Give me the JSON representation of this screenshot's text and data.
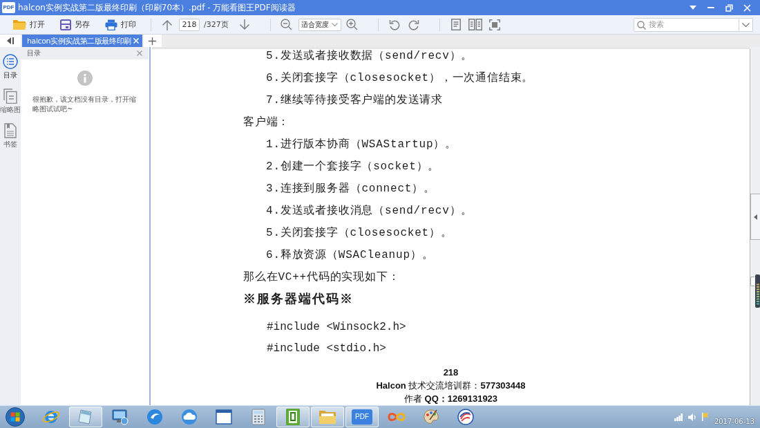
{
  "window": {
    "app_icon_label": "PDF",
    "title": "halcon实例实战第二版最终印刷（印刷70本）.pdf - 万能看图王PDF阅读器"
  },
  "toolbar": {
    "file_buttons": [
      {
        "kind": "open",
        "label": "打开"
      },
      {
        "kind": "save",
        "label": "另存"
      },
      {
        "kind": "print",
        "label": "打印"
      }
    ],
    "page": {
      "current": "218",
      "total": "/327页"
    },
    "zoom_mode": "适合宽度",
    "search": {
      "placeholder": "搜索"
    }
  },
  "tabs": [
    {
      "label": "halcon实例实战第二版最终印刷",
      "selected": true
    }
  ],
  "side_rail": [
    {
      "kind": "toc",
      "label": "目录",
      "selected": true
    },
    {
      "kind": "thumbnails",
      "label": "缩略图",
      "selected": false
    },
    {
      "kind": "bookmarks",
      "label": "书签",
      "selected": false
    }
  ],
  "panel": {
    "title": "目录",
    "message": "很抱歉，该文档没有目录，打开缩略图试试吧~"
  },
  "document": {
    "lines": [
      {
        "kind": "item",
        "text": "5.发送或者接收数据（send/recv）。"
      },
      {
        "kind": "item",
        "text": "6.关闭套接字（closesocket），一次通信结束。"
      },
      {
        "kind": "item",
        "text": "7.继续等待接受客户端的发送请求"
      },
      {
        "kind": "heading",
        "text": "客户端："
      },
      {
        "kind": "item",
        "text": "1.进行版本协商（WSAStartup）。"
      },
      {
        "kind": "item",
        "text": "2.创建一个套接字（socket）。"
      },
      {
        "kind": "item",
        "text": "3.连接到服务器（connect）。"
      },
      {
        "kind": "item",
        "text": "4.发送或者接收消息（send/recv）。"
      },
      {
        "kind": "item",
        "text": "5.关闭套接字（closesocket）。"
      },
      {
        "kind": "item",
        "text": "6.释放资源（WSACleanup）。"
      },
      {
        "kind": "heading",
        "text": "那么在VC++代码的实现如下："
      },
      {
        "kind": "section",
        "text": "※服务器端代码※"
      },
      {
        "kind": "code",
        "text": "#include <Winsock2.h>"
      },
      {
        "kind": "code",
        "text": "#include <stdio.h>"
      }
    ],
    "footer": [
      {
        "kind": "page_number",
        "text": "218"
      },
      {
        "kind": "note",
        "text": "**Halcon** 技术交流培训群：**577303448**"
      },
      {
        "kind": "note",
        "text": "作者 **QQ：1269131923**"
      }
    ]
  },
  "taskbar": {
    "apps": [
      {
        "kind": "browser",
        "running": false
      },
      {
        "kind": "notepad",
        "running": true
      },
      {
        "kind": "network",
        "running": false
      },
      {
        "kind": "swoosh",
        "running": false
      },
      {
        "kind": "cloud",
        "running": false
      },
      {
        "kind": "window",
        "running": false
      },
      {
        "kind": "calculator",
        "running": false
      },
      {
        "kind": "book",
        "running": true
      },
      {
        "kind": "folder",
        "running": true
      },
      {
        "kind": "pdf",
        "label": "PDF",
        "running": true
      },
      {
        "kind": "infinity",
        "running": false
      },
      {
        "kind": "palette",
        "running": false
      },
      {
        "kind": "swirl",
        "running": false
      }
    ],
    "date": "2017-06-13"
  }
}
